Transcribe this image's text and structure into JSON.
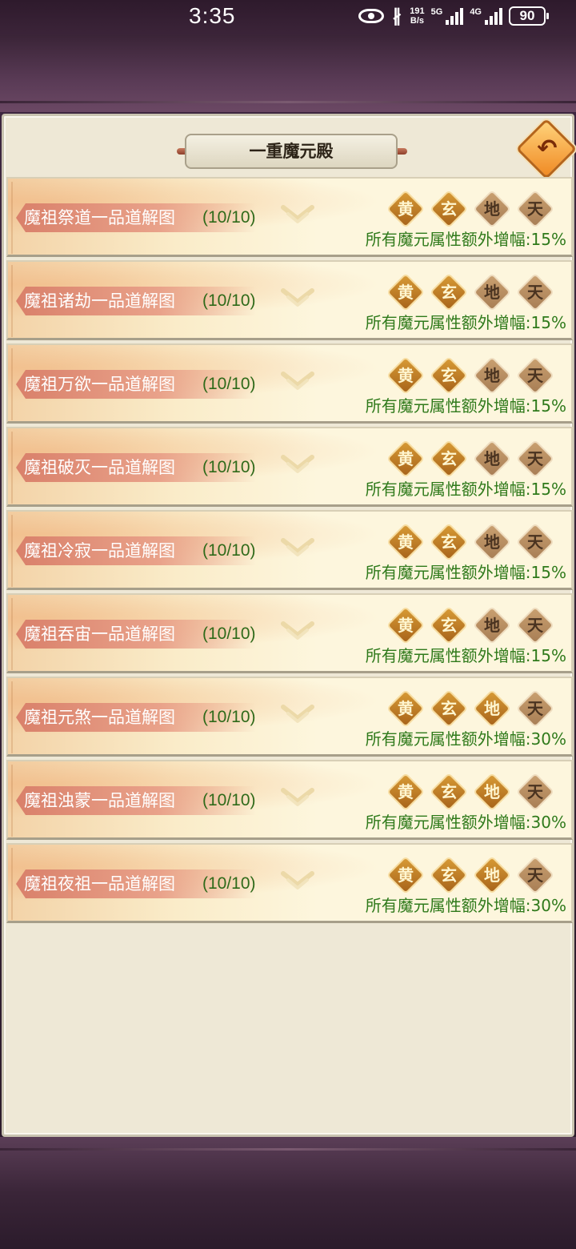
{
  "status_bar": {
    "time": "3:35",
    "speed_value": "191",
    "speed_unit": "B/s",
    "net1": "5G",
    "net2": "4G",
    "battery": "90"
  },
  "panel": {
    "title": "一重魔元殿"
  },
  "grade_labels": [
    "黄",
    "玄",
    "地",
    "天"
  ],
  "rows": [
    {
      "name": "魔祖祭道一品道解图",
      "count": "(10/10)",
      "bonus": "所有魔元属性额外增幅:15%",
      "grades_on": [
        true,
        true,
        false,
        false
      ]
    },
    {
      "name": "魔祖诸劫一品道解图",
      "count": "(10/10)",
      "bonus": "所有魔元属性额外增幅:15%",
      "grades_on": [
        true,
        true,
        false,
        false
      ]
    },
    {
      "name": "魔祖万欲一品道解图",
      "count": "(10/10)",
      "bonus": "所有魔元属性额外增幅:15%",
      "grades_on": [
        true,
        true,
        false,
        false
      ]
    },
    {
      "name": "魔祖破灭一品道解图",
      "count": "(10/10)",
      "bonus": "所有魔元属性额外增幅:15%",
      "grades_on": [
        true,
        true,
        false,
        false
      ]
    },
    {
      "name": "魔祖冷寂一品道解图",
      "count": "(10/10)",
      "bonus": "所有魔元属性额外增幅:15%",
      "grades_on": [
        true,
        true,
        false,
        false
      ]
    },
    {
      "name": "魔祖吞宙一品道解图",
      "count": "(10/10)",
      "bonus": "所有魔元属性额外增幅:15%",
      "grades_on": [
        true,
        true,
        false,
        false
      ]
    },
    {
      "name": "魔祖元煞一品道解图",
      "count": "(10/10)",
      "bonus": "所有魔元属性额外增幅:30%",
      "grades_on": [
        true,
        true,
        true,
        false
      ]
    },
    {
      "name": "魔祖浊蒙一品道解图",
      "count": "(10/10)",
      "bonus": "所有魔元属性额外增幅:30%",
      "grades_on": [
        true,
        true,
        true,
        false
      ]
    },
    {
      "name": "魔祖夜祖一品道解图",
      "count": "(10/10)",
      "bonus": "所有魔元属性额外增幅:30%",
      "grades_on": [
        true,
        true,
        true,
        false
      ]
    }
  ],
  "colors": {
    "bonus_text": "#2f7a1b",
    "grade_on": "#c07f25",
    "grade_off": "#b58d62"
  }
}
